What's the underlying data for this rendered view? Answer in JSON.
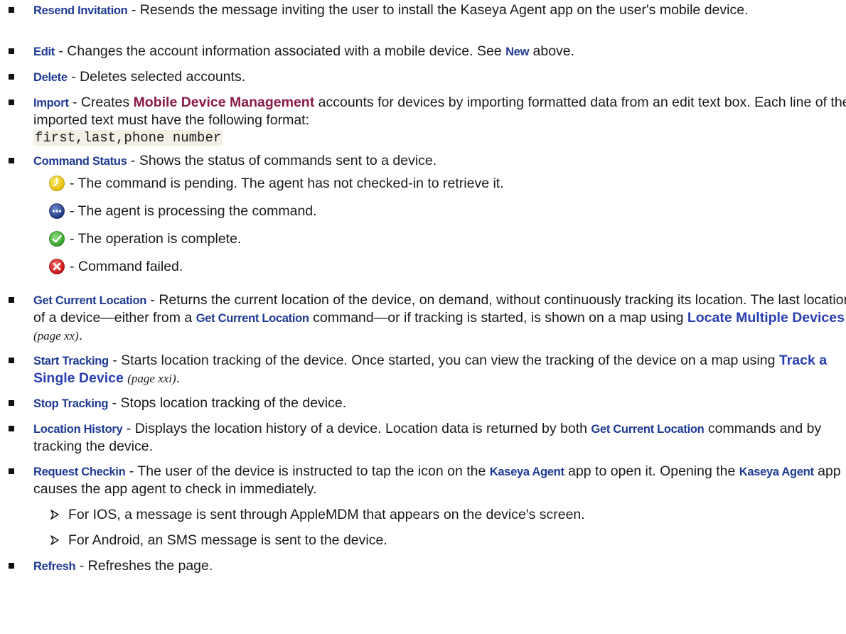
{
  "items": {
    "resend": {
      "term": "Resend Invitation",
      "text": " - Resends the message inviting the user to install the Kaseya Agent app on the user's mobile device."
    },
    "edit": {
      "term": "Edit",
      "text_a": " - Changes the account information associated with a mobile device. See ",
      "link": "New",
      "text_b": " above."
    },
    "delete": {
      "term": "Delete",
      "text": " - Deletes selected accounts."
    },
    "import": {
      "term": "Import",
      "text_a": " - Creates ",
      "strong": "Mobile Device Management",
      "text_b": " accounts for devices by importing formatted data from an edit text box. Each line of the imported text must have the following format:",
      "code": "first,last,phone number"
    },
    "command_status": {
      "term": "Command Status",
      "text": " - Shows the status of commands sent to a device.",
      "statuses": [
        {
          "icon": "pending-clock-icon",
          "text": " - The command is pending. The agent has not checked-in to retrieve it."
        },
        {
          "icon": "processing-dots-icon",
          "text": " - The agent is processing the command."
        },
        {
          "icon": "complete-check-icon",
          "text": " - The operation is complete."
        },
        {
          "icon": "failed-x-icon",
          "text": " - Command failed."
        }
      ]
    },
    "get_location": {
      "term": "Get Current Location",
      "text_a": " - Returns the current location of the device, on demand, without continuously tracking its location. The last location of a device—either from a ",
      "term2": "Get Current Location",
      "text_b": " command—or if tracking is started, is shown on a map using ",
      "link": "Locate Multiple Devices",
      "pageref": "(page xx)",
      "text_c": "."
    },
    "start_tracking": {
      "term": "Start Tracking",
      "text_a": " - Starts location tracking of the device. Once started, you can view the tracking of the device on a map using ",
      "link": "Track a Single Device",
      "pageref": "(page xxi)",
      "text_b": "."
    },
    "stop_tracking": {
      "term": "Stop Tracking",
      "text": " - Stops location tracking of the device."
    },
    "location_history": {
      "term": "Location History",
      "text_a": " - Displays the location history of a device. Location data is returned by both ",
      "term2": "Get Current Location",
      "text_b": " commands and by tracking the device."
    },
    "request_checkin": {
      "term": "Request Checkin",
      "text_a": " - The user of the device is instructed to tap the icon on the ",
      "term2": "Kaseya Agent",
      "text_b": " app to open it. Opening the ",
      "term3": "Kaseya Agent",
      "text_c": " app causes the app agent to check in immediately.",
      "subitems": [
        "For IOS, a message is sent through AppleMDM that appears on the device's screen.",
        "For Android, an SMS message is sent to the device."
      ]
    },
    "refresh": {
      "term": "Refresh",
      "text": " - Refreshes the page."
    }
  },
  "colors": {
    "term": "#1f3a93",
    "link": "#2a3fb0",
    "maroon": "#8b1a4a",
    "code_bg": "#f3f0e6"
  }
}
